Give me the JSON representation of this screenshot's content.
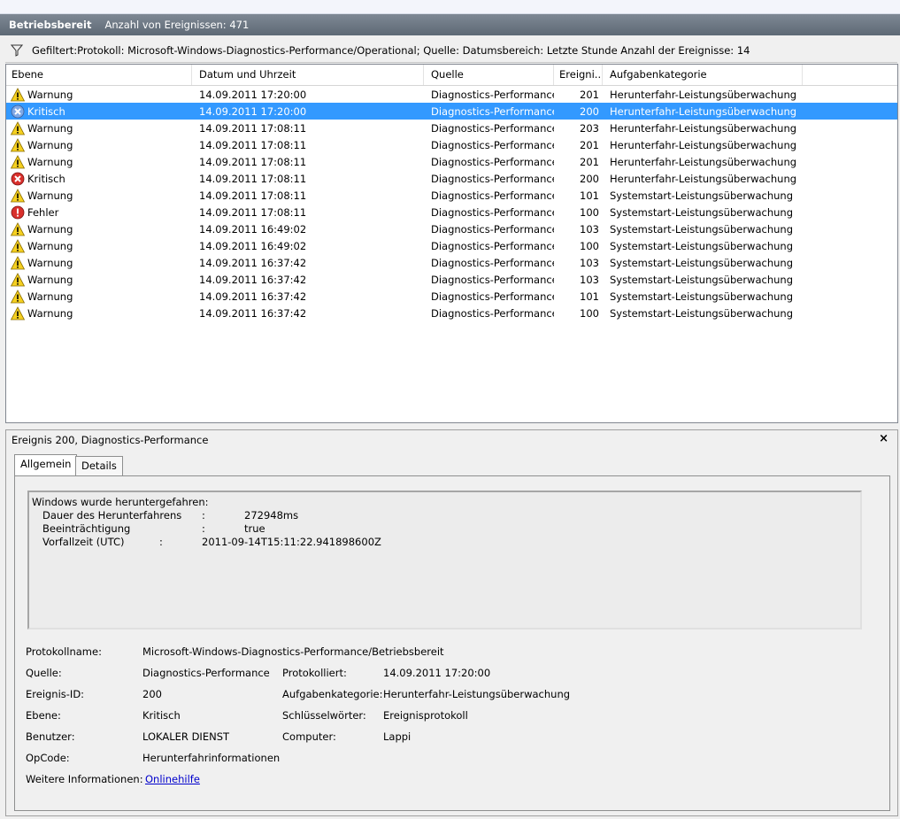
{
  "header": {
    "title": "Betriebsbereit",
    "count": "Anzahl von Ereignissen: 471"
  },
  "filter": {
    "text": "Gefiltert:Protokoll: Microsoft-Windows-Diagnostics-Performance/Operational; Quelle: Datumsbereich: Letzte Stunde Anzahl der Ereignisse: 14"
  },
  "columns": [
    "Ebene",
    "Datum und Uhrzeit",
    "Quelle",
    "Ereigni...",
    "Aufgabenkategorie"
  ],
  "events": [
    {
      "level": "Warnung",
      "icon": "warning-icon",
      "date": "14.09.2011 17:20:00",
      "source": "Diagnostics-Performance",
      "id": "201",
      "category": "Herunterfahr-Leistungsüberwachung"
    },
    {
      "level": "Kritisch",
      "icon": "critical-icon",
      "date": "14.09.2011 17:20:00",
      "source": "Diagnostics-Performance",
      "id": "200",
      "category": "Herunterfahr-Leistungsüberwachung",
      "selected": true
    },
    {
      "level": "Warnung",
      "icon": "warning-icon",
      "date": "14.09.2011 17:08:11",
      "source": "Diagnostics-Performance",
      "id": "203",
      "category": "Herunterfahr-Leistungsüberwachung"
    },
    {
      "level": "Warnung",
      "icon": "warning-icon",
      "date": "14.09.2011 17:08:11",
      "source": "Diagnostics-Performance",
      "id": "201",
      "category": "Herunterfahr-Leistungsüberwachung"
    },
    {
      "level": "Warnung",
      "icon": "warning-icon",
      "date": "14.09.2011 17:08:11",
      "source": "Diagnostics-Performance",
      "id": "201",
      "category": "Herunterfahr-Leistungsüberwachung"
    },
    {
      "level": "Kritisch",
      "icon": "critical-icon",
      "date": "14.09.2011 17:08:11",
      "source": "Diagnostics-Performance",
      "id": "200",
      "category": "Herunterfahr-Leistungsüberwachung"
    },
    {
      "level": "Warnung",
      "icon": "warning-icon",
      "date": "14.09.2011 17:08:11",
      "source": "Diagnostics-Performance",
      "id": "101",
      "category": "Systemstart-Leistungsüberwachung"
    },
    {
      "level": "Fehler",
      "icon": "error-icon",
      "date": "14.09.2011 17:08:11",
      "source": "Diagnostics-Performance",
      "id": "100",
      "category": "Systemstart-Leistungsüberwachung"
    },
    {
      "level": "Warnung",
      "icon": "warning-icon",
      "date": "14.09.2011 16:49:02",
      "source": "Diagnostics-Performance",
      "id": "103",
      "category": "Systemstart-Leistungsüberwachung"
    },
    {
      "level": "Warnung",
      "icon": "warning-icon",
      "date": "14.09.2011 16:49:02",
      "source": "Diagnostics-Performance",
      "id": "100",
      "category": "Systemstart-Leistungsüberwachung"
    },
    {
      "level": "Warnung",
      "icon": "warning-icon",
      "date": "14.09.2011 16:37:42",
      "source": "Diagnostics-Performance",
      "id": "103",
      "category": "Systemstart-Leistungsüberwachung"
    },
    {
      "level": "Warnung",
      "icon": "warning-icon",
      "date": "14.09.2011 16:37:42",
      "source": "Diagnostics-Performance",
      "id": "103",
      "category": "Systemstart-Leistungsüberwachung"
    },
    {
      "level": "Warnung",
      "icon": "warning-icon",
      "date": "14.09.2011 16:37:42",
      "source": "Diagnostics-Performance",
      "id": "101",
      "category": "Systemstart-Leistungsüberwachung"
    },
    {
      "level": "Warnung",
      "icon": "warning-icon",
      "date": "14.09.2011 16:37:42",
      "source": "Diagnostics-Performance",
      "id": "100",
      "category": "Systemstart-Leistungsüberwachung"
    }
  ],
  "detail": {
    "title": "Ereignis 200, Diagnostics-Performance",
    "close": "×",
    "tabs": [
      "Allgemein",
      "Details"
    ],
    "message": {
      "heading": "Windows wurde heruntergefahren:",
      "lines": [
        {
          "key": "Dauer des Herunterfahrens",
          "sep": ":",
          "value": "272948ms"
        },
        {
          "key": "Beeinträchtigung",
          "sep": ":",
          "value": "true"
        },
        {
          "key": "Vorfallzeit (UTC)",
          "sep": ":",
          "value": "2011-09-14T15:11:22.941898600Z"
        }
      ]
    },
    "props": {
      "logname_label": "Protokollname:",
      "logname": "Microsoft-Windows-Diagnostics-Performance/Betriebsbereit",
      "source_label": "Quelle:",
      "source": "Diagnostics-Performance",
      "logged_label": "Protokolliert:",
      "logged": "14.09.2011 17:20:00",
      "eventid_label": "Ereignis-ID:",
      "eventid": "200",
      "taskcat_label": "Aufgabenkategorie:",
      "taskcat": "Herunterfahr-Leistungsüberwachung",
      "level_label": "Ebene:",
      "level": "Kritisch",
      "keywords_label": "Schlüsselwörter:",
      "keywords": "Ereignisprotokoll",
      "user_label": "Benutzer:",
      "user": "LOKALER DIENST",
      "computer_label": "Computer:",
      "computer": "Lappi",
      "opcode_label": "OpCode:",
      "opcode": "Herunterfahrinformationen",
      "moreinfo_label": "Weitere Informationen:",
      "moreinfo_link": "Onlinehilfe"
    }
  },
  "colors": {
    "selection": "#3399ff",
    "header_bar": "#66707c",
    "link": "#0000cc"
  }
}
